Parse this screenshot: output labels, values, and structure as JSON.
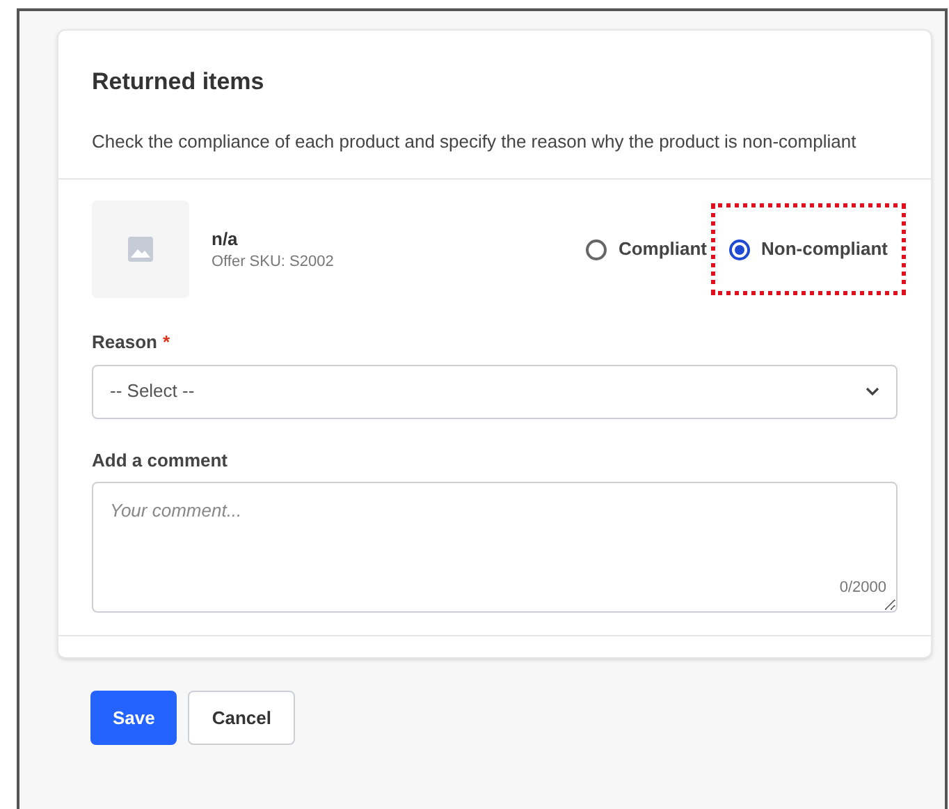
{
  "card": {
    "title": "Returned items",
    "description": "Check the compliance of each product and specify the reason why the product is non-compliant"
  },
  "product": {
    "image": {
      "kind": "placeholder"
    },
    "name": "n/a",
    "sku": "Offer SKU: S2002",
    "options": [
      {
        "label": "Compliant",
        "selected": false,
        "highlighted": false
      },
      {
        "label": "Non-compliant",
        "selected": true,
        "highlighted": true
      }
    ]
  },
  "reason": {
    "label": "Reason",
    "required_mark": "*",
    "placeholder": "-- Select --"
  },
  "comment": {
    "label": "Add a comment",
    "placeholder": "Your comment...",
    "counter": "0/2000"
  },
  "buttons": [
    {
      "label": "Save",
      "kind": "primary"
    },
    {
      "label": "Cancel",
      "kind": "secondary"
    }
  ]
}
